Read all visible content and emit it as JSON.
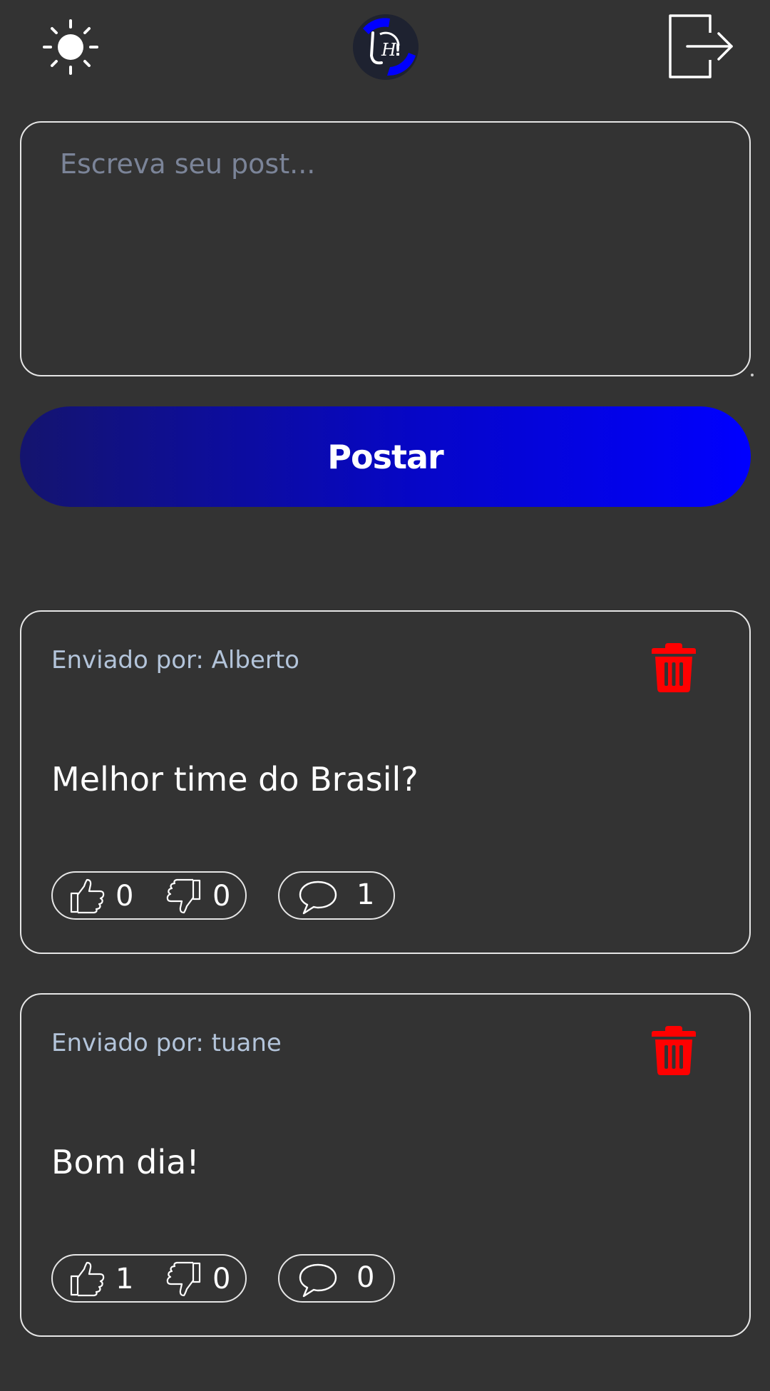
{
  "header": {
    "theme_icon": "sun-icon",
    "logo_icon": "app-logo",
    "logout_icon": "logout-icon"
  },
  "composer": {
    "placeholder": "Escreva seu post..."
  },
  "post_button": {
    "label": "Postar"
  },
  "posts": [
    {
      "author": "Enviado por: Alberto",
      "text": "Melhor time do Brasil?",
      "likes": "0",
      "dislikes": "0",
      "comments": "1"
    },
    {
      "author": "Enviado por: tuane",
      "text": "Bom dia!",
      "likes": "1",
      "dislikes": "0",
      "comments": "0"
    }
  ],
  "colors": {
    "background": "#333333",
    "accent_start": "#14146e",
    "accent_end": "#0000ff",
    "delete": "#ff0000",
    "author_text": "#b3c4da"
  }
}
